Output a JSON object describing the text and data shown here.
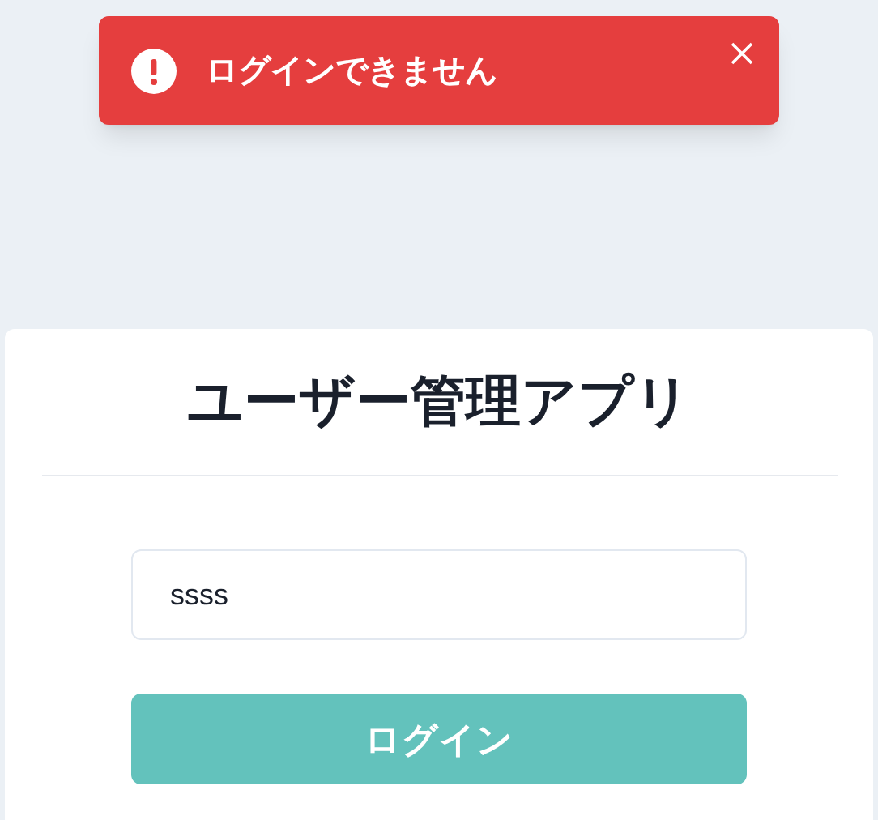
{
  "toast": {
    "message": "ログインできません"
  },
  "card": {
    "title": "ユーザー管理アプリ",
    "input": {
      "value": "ssss"
    },
    "button": {
      "label": "ログイン"
    }
  }
}
